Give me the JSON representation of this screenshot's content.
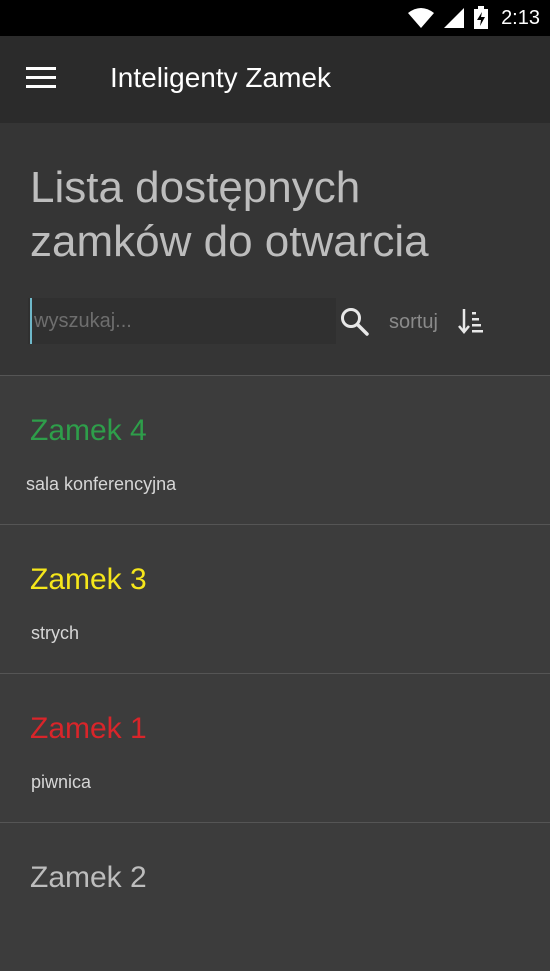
{
  "status_bar": {
    "time": "2:13"
  },
  "app_bar": {
    "title": "Inteligenty Zamek",
    "menu_icon": "hamburger-menu-icon"
  },
  "header": {
    "title": "Lista dostępnych zamków do otwarcia",
    "search": {
      "placeholder": "wyszukaj...",
      "value": ""
    },
    "sort_label": "sortuj"
  },
  "locks": [
    {
      "name": "Zamek 4",
      "description": "sala konferencyjna",
      "color": "#2e9e4a"
    },
    {
      "name": "Zamek 3",
      "description": "strych",
      "color": "#f5e61b"
    },
    {
      "name": "Zamek 1",
      "description": "piwnica",
      "color": "#d9252a"
    },
    {
      "name": "Zamek 2",
      "description": "",
      "color": "#bdbdbd"
    }
  ]
}
